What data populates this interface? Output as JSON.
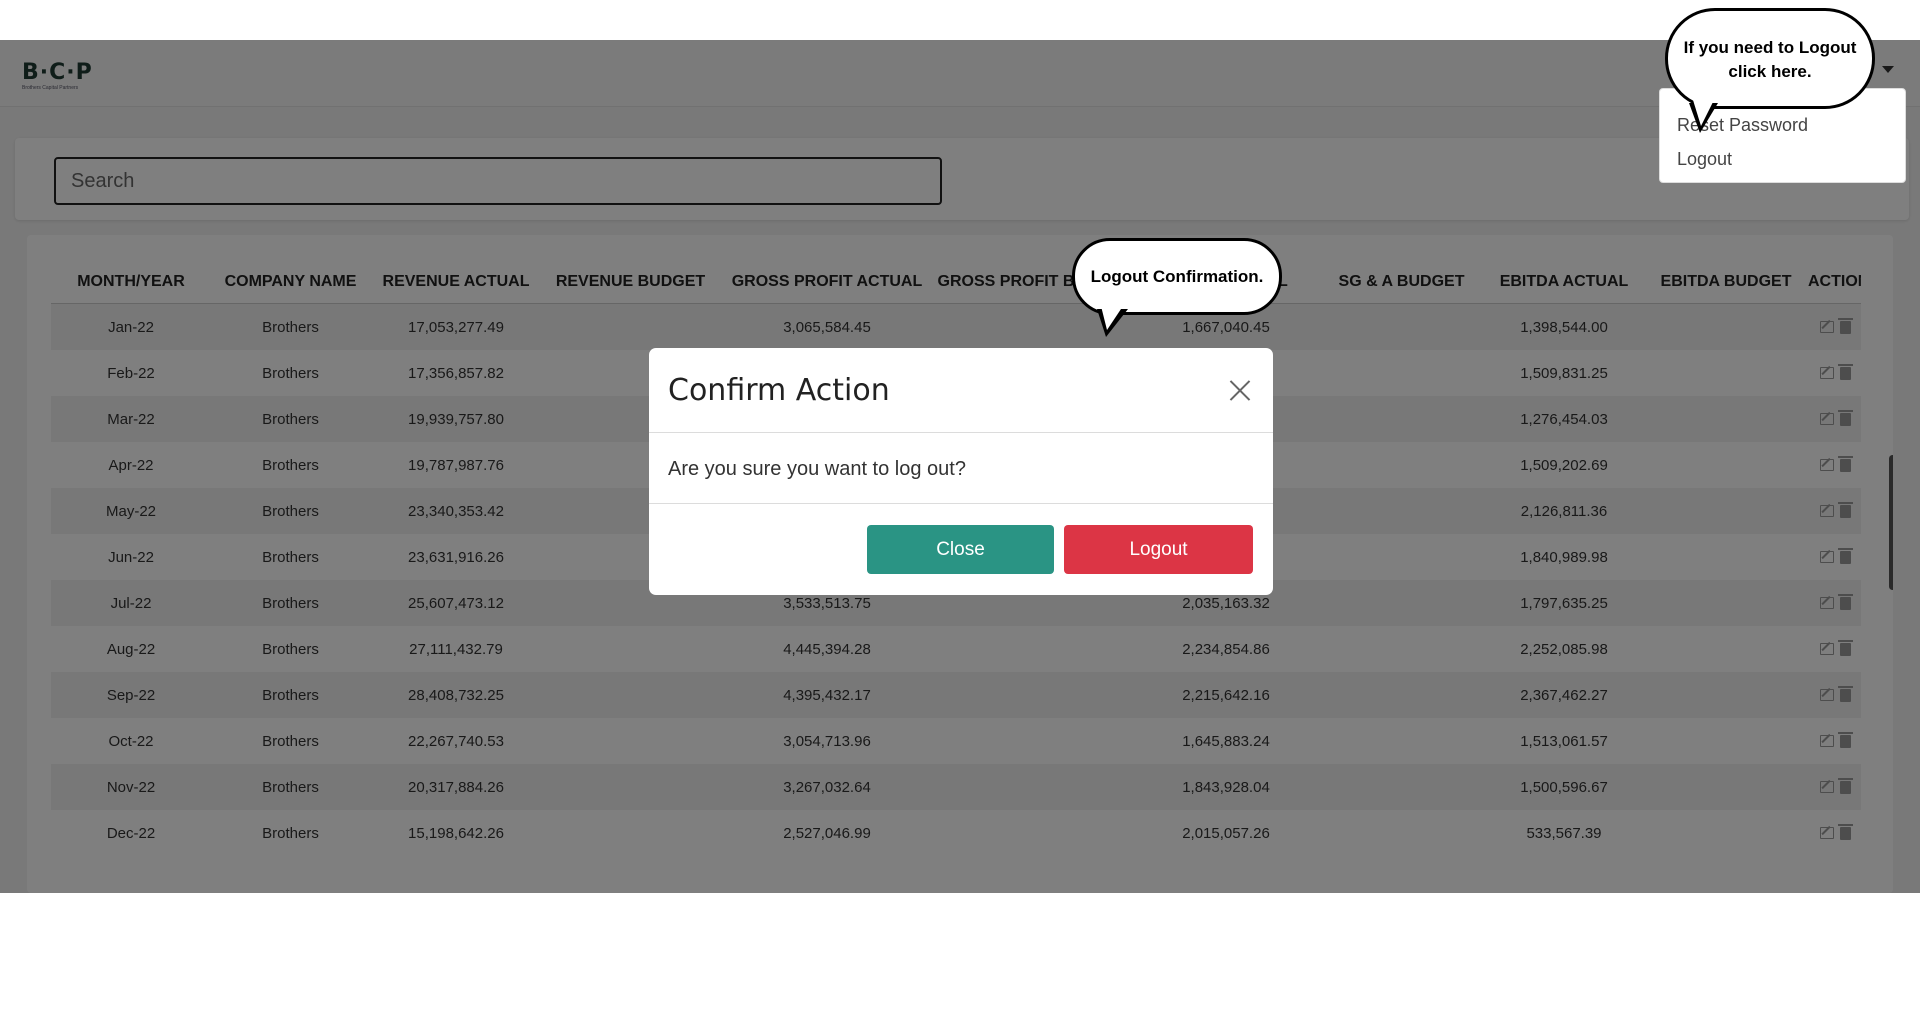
{
  "header": {
    "logo_text": "B·C·P",
    "logo_subtext": "Brothers Capital Partners"
  },
  "user_menu": {
    "items": [
      "Reset Password",
      "Logout"
    ]
  },
  "search": {
    "placeholder": "Search"
  },
  "table": {
    "columns": [
      "MONTH/YEAR",
      "COMPANY NAME",
      "REVENUE ACTUAL",
      "REVENUE BUDGET",
      "GROSS PROFIT ACTUAL",
      "GROSS PROFIT BUDGET",
      "SG & A ACTUAL",
      "SG & A BUDGET",
      "EBITDA ACTUAL",
      "EBITDA BUDGET",
      "ACTION"
    ],
    "rows": [
      [
        "Jan-22",
        "Brothers",
        "17,053,277.49",
        "",
        "3,065,584.45",
        "",
        "1,667,040.45",
        "",
        "1,398,544.00",
        ""
      ],
      [
        "Feb-22",
        "Brothers",
        "17,356,857.82",
        "",
        "",
        "",
        "",
        "",
        "1,509,831.25",
        ""
      ],
      [
        "Mar-22",
        "Brothers",
        "19,939,757.80",
        "",
        "",
        "",
        "",
        "",
        "1,276,454.03",
        ""
      ],
      [
        "Apr-22",
        "Brothers",
        "19,787,987.76",
        "",
        "",
        "",
        "",
        "",
        "1,509,202.69",
        ""
      ],
      [
        "May-22",
        "Brothers",
        "23,340,353.42",
        "",
        "",
        "",
        "",
        "",
        "2,126,811.36",
        ""
      ],
      [
        "Jun-22",
        "Brothers",
        "23,631,916.26",
        "",
        "",
        "",
        "",
        "",
        "1,840,989.98",
        ""
      ],
      [
        "Jul-22",
        "Brothers",
        "25,607,473.12",
        "",
        "3,533,513.75",
        "",
        "2,035,163.32",
        "",
        "1,797,635.25",
        ""
      ],
      [
        "Aug-22",
        "Brothers",
        "27,111,432.79",
        "",
        "4,445,394.28",
        "",
        "2,234,854.86",
        "",
        "2,252,085.98",
        ""
      ],
      [
        "Sep-22",
        "Brothers",
        "28,408,732.25",
        "",
        "4,395,432.17",
        "",
        "2,215,642.16",
        "",
        "2,367,462.27",
        ""
      ],
      [
        "Oct-22",
        "Brothers",
        "22,267,740.53",
        "",
        "3,054,713.96",
        "",
        "1,645,883.24",
        "",
        "1,513,061.57",
        ""
      ],
      [
        "Nov-22",
        "Brothers",
        "20,317,884.26",
        "",
        "3,267,032.64",
        "",
        "1,843,928.04",
        "",
        "1,500,596.67",
        ""
      ],
      [
        "Dec-22",
        "Brothers",
        "15,198,642.26",
        "",
        "2,527,046.99",
        "",
        "2,015,057.26",
        "",
        "533,567.39",
        ""
      ]
    ]
  },
  "modal": {
    "title": "Confirm Action",
    "message": "Are you sure you want to log out?",
    "close_label": "Close",
    "logout_label": "Logout"
  },
  "callouts": {
    "top": "If you need to Logout click here.",
    "middle": "Logout  Confirmation."
  },
  "colors": {
    "close_button": "#2a9484",
    "logout_button": "#dc3545",
    "overlay": "rgba(0,0,0,0.5)"
  },
  "icons": {
    "edit": "edit-icon",
    "delete": "trash-icon",
    "close": "close-icon",
    "dropdown": "caret-down-icon"
  }
}
